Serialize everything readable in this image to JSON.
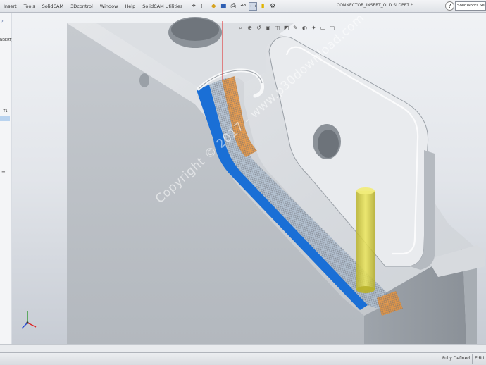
{
  "menus": [
    "Insert",
    "Tools",
    "SolidCAM",
    "3Dcontrol",
    "Window",
    "Help",
    "SolidCAM Utilities"
  ],
  "title": "CONNECTOR_INSERT_OLD.SLDPRT *",
  "search": {
    "value": "SolidWorks Se"
  },
  "help_glyph": "?",
  "left_panel": {
    "label_top": "NSERT)",
    "label_mid": "_T1"
  },
  "watermark": "Copyright © 2017 - www.p30download.com",
  "status": {
    "fully_defined": "Fully Defined",
    "editing": "Editi"
  },
  "colors": {
    "toolpath_blue": "#1a6fd6",
    "toolpath_orange": "#e8923a",
    "tool_yellow": "#d8d23a",
    "model_gray": "#c9cdd2"
  },
  "icons": [
    "new-doc-icon",
    "open-icon",
    "save-icon",
    "print-icon",
    "undo-icon",
    "select-icon",
    "rebuild-icon",
    "options-icon"
  ]
}
